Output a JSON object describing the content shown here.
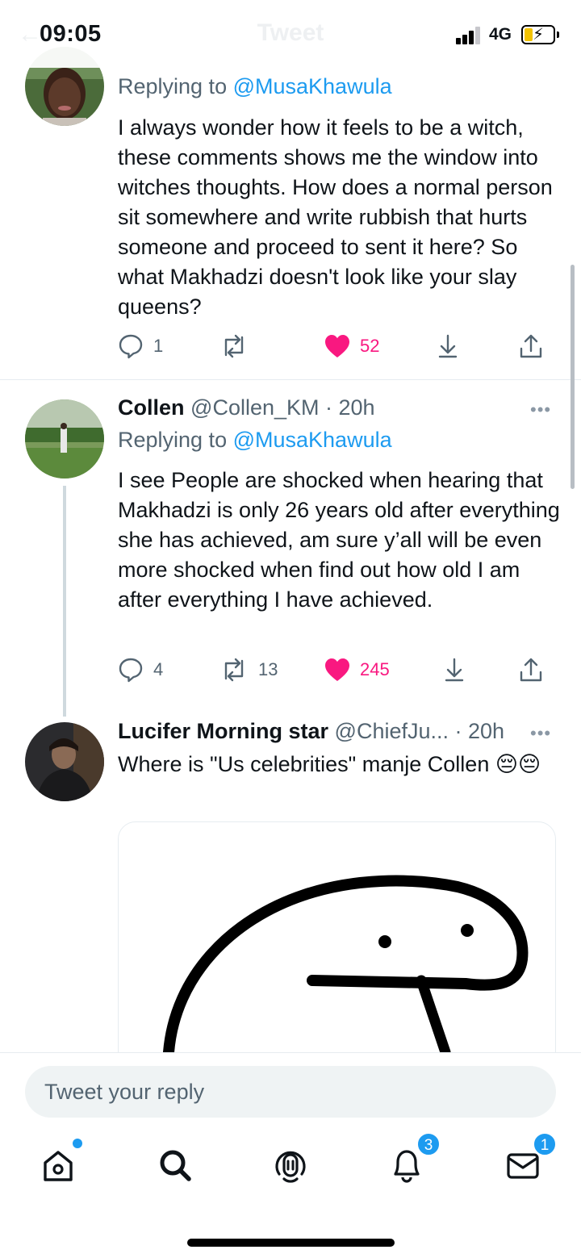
{
  "status_bar": {
    "time": "09:05",
    "network": "4G",
    "title": "Tweet"
  },
  "tweets": [
    {
      "replying_prefix": "Replying to ",
      "replying_to": "@MusaKhawula",
      "text": "I always wonder how it feels to be a witch, these comments shows me the window into witches thoughts. How does a normal person  sit somewhere and write rubbish that hurts someone and proceed to sent it here? So what Makhadzi doesn't look like your slay queens?",
      "replies": "1",
      "retweets": "",
      "likes": "52"
    },
    {
      "name": "Collen",
      "handle": "@Collen_KM",
      "time": "· 20h",
      "replying_prefix": "Replying to ",
      "replying_to": "@MusaKhawula",
      "text": "I see People are shocked when hearing that Makhadzi is only 26 years old after everything she has achieved, am sure y’all will be even more shocked when find out how old I am after everything I have achieved.",
      "replies": "4",
      "retweets": "13",
      "likes": "245"
    },
    {
      "name": "Lucifer Morning star",
      "handle": "@ChiefJu...",
      "time": "· 20h",
      "text": "Where is \"Us celebrities\" manje Collen 😔😔"
    }
  ],
  "reply_bar": {
    "placeholder": "Tweet your reply"
  },
  "tab_bar": {
    "notifications_badge": "3",
    "messages_badge": "1"
  },
  "colors": {
    "accent": "#1d9bf0",
    "like": "#f91880",
    "secondary_text": "#536471"
  }
}
